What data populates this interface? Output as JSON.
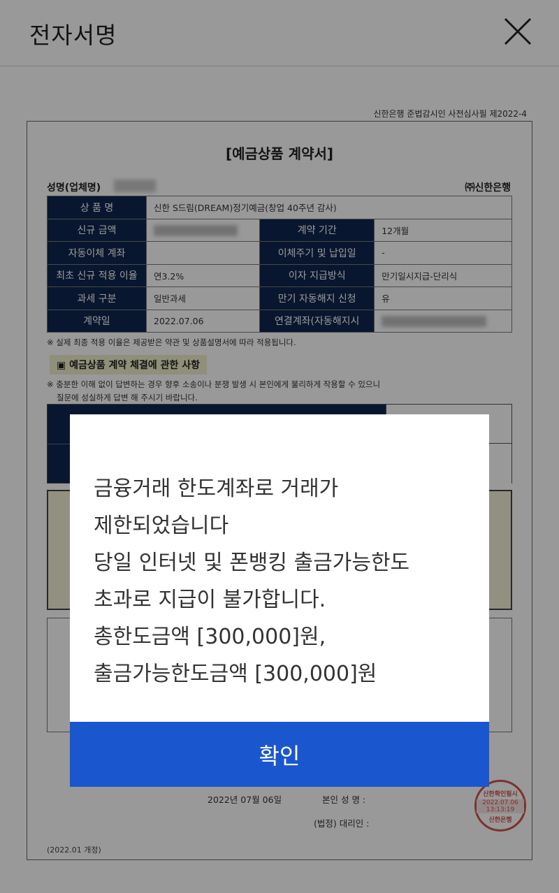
{
  "header": {
    "title": "전자서명",
    "close_icon": "close-icon"
  },
  "document": {
    "review_note": "신한은행 준법감시인 사전심사필 제2022-4",
    "title": "[예금상품 계약서]",
    "name_label": "성명(업체명)",
    "bank_label": "㈜신한은행",
    "rows": {
      "product_h": "상 품 명",
      "product_v": "신한 S드림(DREAM)정기예금(창업 40주년 감사)",
      "amount_h": "신규 금액",
      "period_h": "계약 기간",
      "period_v": "12개월",
      "autoacct_h": "자동이체 계좌",
      "cycle_h": "이체주기 및 납입일",
      "cycle_v": "-",
      "rate_h": "최초 신규 적용 이율",
      "rate_v": "연3.2%",
      "interest_h": "이자 지급방식",
      "interest_v": "만기일시지급-단리식",
      "tax_h": "과세 구분",
      "tax_v": "일반과세",
      "auto_cancel_h": "만기 자동해지 신청",
      "auto_cancel_v": "유",
      "contract_date_h": "계약일",
      "contract_date_v": "2022.07.06",
      "linked_acct_h": "연결계좌(자동해지시"
    },
    "note1": "※ 실제 최종 적용 이율은 제공받은 약관 및 상품설명서에 따라 적용됩니다.",
    "section_tag": "▣ 예금상품 계약 체결에 관한 사항",
    "note2_line1": "※ 충분한 이해 없이 답변하는 경우 향후 소송이나 분쟁 발생 시 본인에게 불리하게 작용할 수 있으니",
    "note2_line2": "질문에 성실하게 답변 해 주시기 바랍니다.",
    "date": "2022년 07월 06일",
    "sign_label": "본인 성 명 :",
    "agent_label": "(법정) 대리인 :",
    "revision": "(2022.01 개정)",
    "stamp_line1": "신한확인필시",
    "stamp_line2": "2022.07.06",
    "stamp_line3": "13:13:19",
    "stamp_line4": "신한은행"
  },
  "modal": {
    "message_lines": [
      "금융거래 한도계좌로 거래가",
      "제한되었습니다",
      "당일 인터넷 및 폰뱅킹 출금가능한도",
      "초과로 지급이 불가합니다.",
      "총한도금액 [300,000]원,",
      "출금가능한도금액 [300,000]원"
    ],
    "confirm_label": "확인"
  },
  "colors": {
    "table_header": "#10254f",
    "confirm_button": "#1a57cf",
    "stamp": "#c9342c"
  }
}
